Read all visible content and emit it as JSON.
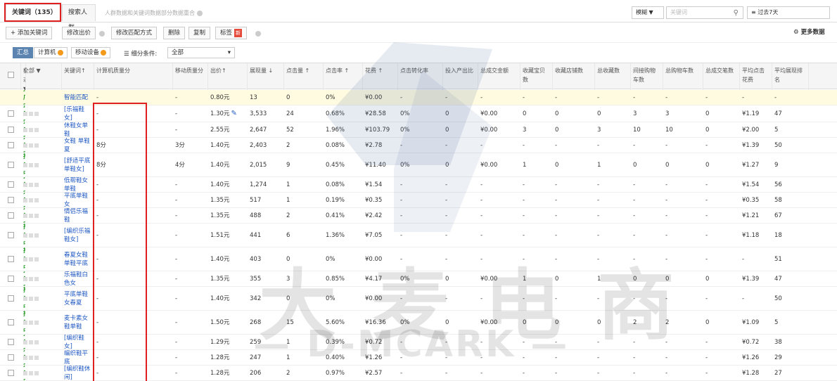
{
  "tabs": {
    "keyword": "关键词（135）",
    "crowd": "搜索人群",
    "note": "人群数据和关键词数据部分数据重合"
  },
  "search": {
    "mode": "模糊 ▼",
    "placeholder": "关键词",
    "range": "≡ 过去7天"
  },
  "toolbar": {
    "add": "+ 添加关键词",
    "modify_bid": "修改出价",
    "modify_match": "修改匹配方式",
    "delete": "删除",
    "copy": "复制",
    "tag": "标签",
    "new_badge": "新",
    "more_data": "⚙ 更多数据"
  },
  "filter": {
    "summary": "汇总",
    "computer": "计算机",
    "mobile": "移动设备",
    "sub_label": "细分条件:",
    "sub_value": "全部"
  },
  "headers": [
    "状态 ▼",
    "全部 ▼",
    "关键词↑",
    "计算机质量分",
    "移动质量分",
    "出价↑",
    "展现量 ↓",
    "点击量 ↑",
    "点击率 ↑",
    "花费 ↑",
    "点击转化率",
    "投入产出比",
    "总成交金额",
    "收藏宝贝数",
    "收藏店铺数",
    "总收藏数",
    "间接购物车数",
    "总购物车数",
    "总成交笔数",
    "平均点击花费",
    "平均展现排名"
  ],
  "rows": [
    {
      "status": "推广中",
      "kw": "智能匹配",
      "pc": "-",
      "mob": "-",
      "bid": "0.80元",
      "imp": "13",
      "clk": "0",
      "ctr": "0%",
      "cost": "¥0.00",
      "cvr": "-",
      "roi": "-",
      "gmv": "-",
      "fav_i": "-",
      "fav_s": "-",
      "fav_t": "-",
      "cart_i": "-",
      "cart_t": "-",
      "ord": "-",
      "cpc": "-",
      "rank": "-"
    },
    {
      "status": "推广中",
      "kw": "[乐福鞋女]",
      "pc": "-",
      "mob": "-",
      "bid": "1.30元",
      "imp": "3,533",
      "clk": "24",
      "ctr": "0.68%",
      "cost": "¥28.58",
      "cvr": "0%",
      "roi": "0",
      "gmv": "¥0.00",
      "fav_i": "0",
      "fav_s": "0",
      "fav_t": "0",
      "cart_i": "3",
      "cart_t": "3",
      "ord": "0",
      "cpc": "¥1.19",
      "rank": "47"
    },
    {
      "status": "推广中",
      "kw": "休鞋女单鞋",
      "pc": "-",
      "mob": "-",
      "bid": "2.55元",
      "imp": "2,647",
      "clk": "52",
      "ctr": "1.96%",
      "cost": "¥103.79",
      "cvr": "0%",
      "roi": "0",
      "gmv": "¥0.00",
      "fav_i": "3",
      "fav_s": "0",
      "fav_t": "3",
      "cart_i": "10",
      "cart_t": "10",
      "ord": "0",
      "cpc": "¥2.00",
      "rank": "5"
    },
    {
      "status": "推广中",
      "kw": "女鞋 单鞋 夏",
      "pc": "8分",
      "mob": "3分",
      "bid": "1.40元",
      "imp": "2,403",
      "clk": "2",
      "ctr": "0.08%",
      "cost": "¥2.78",
      "cvr": "-",
      "roi": "-",
      "gmv": "-",
      "fav_i": "-",
      "fav_s": "-",
      "fav_t": "-",
      "cart_i": "-",
      "cart_t": "-",
      "ord": "-",
      "cpc": "¥1.39",
      "rank": "50"
    },
    {
      "status": "推广中",
      "kw": "[舒适平底单鞋女]",
      "pc": "8分",
      "mob": "4分",
      "bid": "1.40元",
      "imp": "2,015",
      "clk": "9",
      "ctr": "0.45%",
      "cost": "¥11.40",
      "cvr": "0%",
      "roi": "0",
      "gmv": "¥0.00",
      "fav_i": "1",
      "fav_s": "0",
      "fav_t": "1",
      "cart_i": "0",
      "cart_t": "0",
      "ord": "0",
      "cpc": "¥1.27",
      "rank": "9"
    },
    {
      "status": "推广中",
      "kw": "低帮鞋女单鞋",
      "pc": "-",
      "mob": "-",
      "bid": "1.40元",
      "imp": "1,274",
      "clk": "1",
      "ctr": "0.08%",
      "cost": "¥1.54",
      "cvr": "-",
      "roi": "-",
      "gmv": "-",
      "fav_i": "-",
      "fav_s": "-",
      "fav_t": "-",
      "cart_i": "-",
      "cart_t": "-",
      "ord": "-",
      "cpc": "¥1.54",
      "rank": "56"
    },
    {
      "status": "推广中",
      "kw": "平底单鞋女",
      "pc": "-",
      "mob": "-",
      "bid": "1.35元",
      "imp": "517",
      "clk": "1",
      "ctr": "0.19%",
      "cost": "¥0.35",
      "cvr": "-",
      "roi": "-",
      "gmv": "-",
      "fav_i": "-",
      "fav_s": "-",
      "fav_t": "-",
      "cart_i": "-",
      "cart_t": "-",
      "ord": "-",
      "cpc": "¥0.35",
      "rank": "58"
    },
    {
      "status": "推广中",
      "kw": "情侣乐福鞋",
      "pc": "-",
      "mob": "-",
      "bid": "1.35元",
      "imp": "488",
      "clk": "2",
      "ctr": "0.41%",
      "cost": "¥2.42",
      "cvr": "-",
      "roi": "-",
      "gmv": "-",
      "fav_i": "-",
      "fav_s": "-",
      "fav_t": "-",
      "cart_i": "-",
      "cart_t": "-",
      "ord": "-",
      "cpc": "¥1.21",
      "rank": "67"
    },
    {
      "status": "推广中",
      "kw": "[编织乐福鞋女]",
      "pc": "-",
      "mob": "-",
      "bid": "1.51元",
      "imp": "441",
      "clk": "6",
      "ctr": "1.36%",
      "cost": "¥7.05",
      "cvr": "-",
      "roi": "-",
      "gmv": "-",
      "fav_i": "-",
      "fav_s": "-",
      "fav_t": "-",
      "cart_i": "-",
      "cart_t": "-",
      "ord": "-",
      "cpc": "¥1.18",
      "rank": "18"
    },
    {
      "status": "推广中",
      "kw": "春夏女鞋 单鞋平底",
      "pc": "-",
      "mob": "-",
      "bid": "1.40元",
      "imp": "403",
      "clk": "0",
      "ctr": "0%",
      "cost": "¥0.00",
      "cvr": "-",
      "roi": "-",
      "gmv": "-",
      "fav_i": "-",
      "fav_s": "-",
      "fav_t": "-",
      "cart_i": "-",
      "cart_t": "-",
      "ord": "-",
      "cpc": "-",
      "rank": "51"
    },
    {
      "status": "推广中",
      "kw": "乐福鞋白色女",
      "pc": "-",
      "mob": "-",
      "bid": "1.35元",
      "imp": "355",
      "clk": "3",
      "ctr": "0.85%",
      "cost": "¥4.17",
      "cvr": "0%",
      "roi": "0",
      "gmv": "¥0.00",
      "fav_i": "1",
      "fav_s": "0",
      "fav_t": "1",
      "cart_i": "0",
      "cart_t": "0",
      "ord": "0",
      "cpc": "¥1.39",
      "rank": "47"
    },
    {
      "status": "推广中",
      "kw": "平底单鞋 女春夏",
      "pc": "-",
      "mob": "-",
      "bid": "1.40元",
      "imp": "342",
      "clk": "0",
      "ctr": "0%",
      "cost": "¥0.00",
      "cvr": "-",
      "roi": "-",
      "gmv": "-",
      "fav_i": "-",
      "fav_s": "-",
      "fav_t": "-",
      "cart_i": "-",
      "cart_t": "-",
      "ord": "-",
      "cpc": "-",
      "rank": "50"
    },
    {
      "status": "推广中",
      "kw": "麦卡素女鞋单鞋",
      "pc": "-",
      "mob": "-",
      "bid": "1.50元",
      "imp": "268",
      "clk": "15",
      "ctr": "5.60%",
      "cost": "¥16.36",
      "cvr": "0%",
      "roi": "0",
      "gmv": "¥0.00",
      "fav_i": "0",
      "fav_s": "0",
      "fav_t": "0",
      "cart_i": "2",
      "cart_t": "2",
      "ord": "0",
      "cpc": "¥1.09",
      "rank": "5"
    },
    {
      "status": "推广中",
      "kw": "[编织鞋女]",
      "pc": "-",
      "mob": "-",
      "bid": "1.29元",
      "imp": "259",
      "clk": "1",
      "ctr": "0.39%",
      "cost": "¥0.72",
      "cvr": "-",
      "roi": "-",
      "gmv": "-",
      "fav_i": "-",
      "fav_s": "-",
      "fav_t": "-",
      "cart_i": "-",
      "cart_t": "-",
      "ord": "-",
      "cpc": "¥0.72",
      "rank": "38"
    },
    {
      "status": "推广中",
      "kw": "编织鞋平底",
      "pc": "-",
      "mob": "-",
      "bid": "1.28元",
      "imp": "247",
      "clk": "1",
      "ctr": "0.40%",
      "cost": "¥1.26",
      "cvr": "-",
      "roi": "-",
      "gmv": "-",
      "fav_i": "-",
      "fav_s": "-",
      "fav_t": "-",
      "cart_i": "-",
      "cart_t": "-",
      "ord": "-",
      "cpc": "¥1.26",
      "rank": "29"
    },
    {
      "status": "推广中",
      "kw": "[编织鞋休闲]",
      "pc": "-",
      "mob": "-",
      "bid": "1.28元",
      "imp": "206",
      "clk": "2",
      "ctr": "0.97%",
      "cost": "¥2.57",
      "cvr": "-",
      "roi": "-",
      "gmv": "-",
      "fav_i": "-",
      "fav_s": "-",
      "fav_t": "-",
      "cart_i": "-",
      "cart_t": "-",
      "ord": "-",
      "cpc": "¥1.28",
      "rank": "27"
    }
  ],
  "watermark": {
    "cn": "大 麦 电 商",
    "en": "— D-MCARK —"
  },
  "colors": {
    "status_green": "#2a9c2a",
    "link_blue": "#1f58c2",
    "highlight_red": "#e02020",
    "smart_row_bg": "#fffbe0"
  }
}
